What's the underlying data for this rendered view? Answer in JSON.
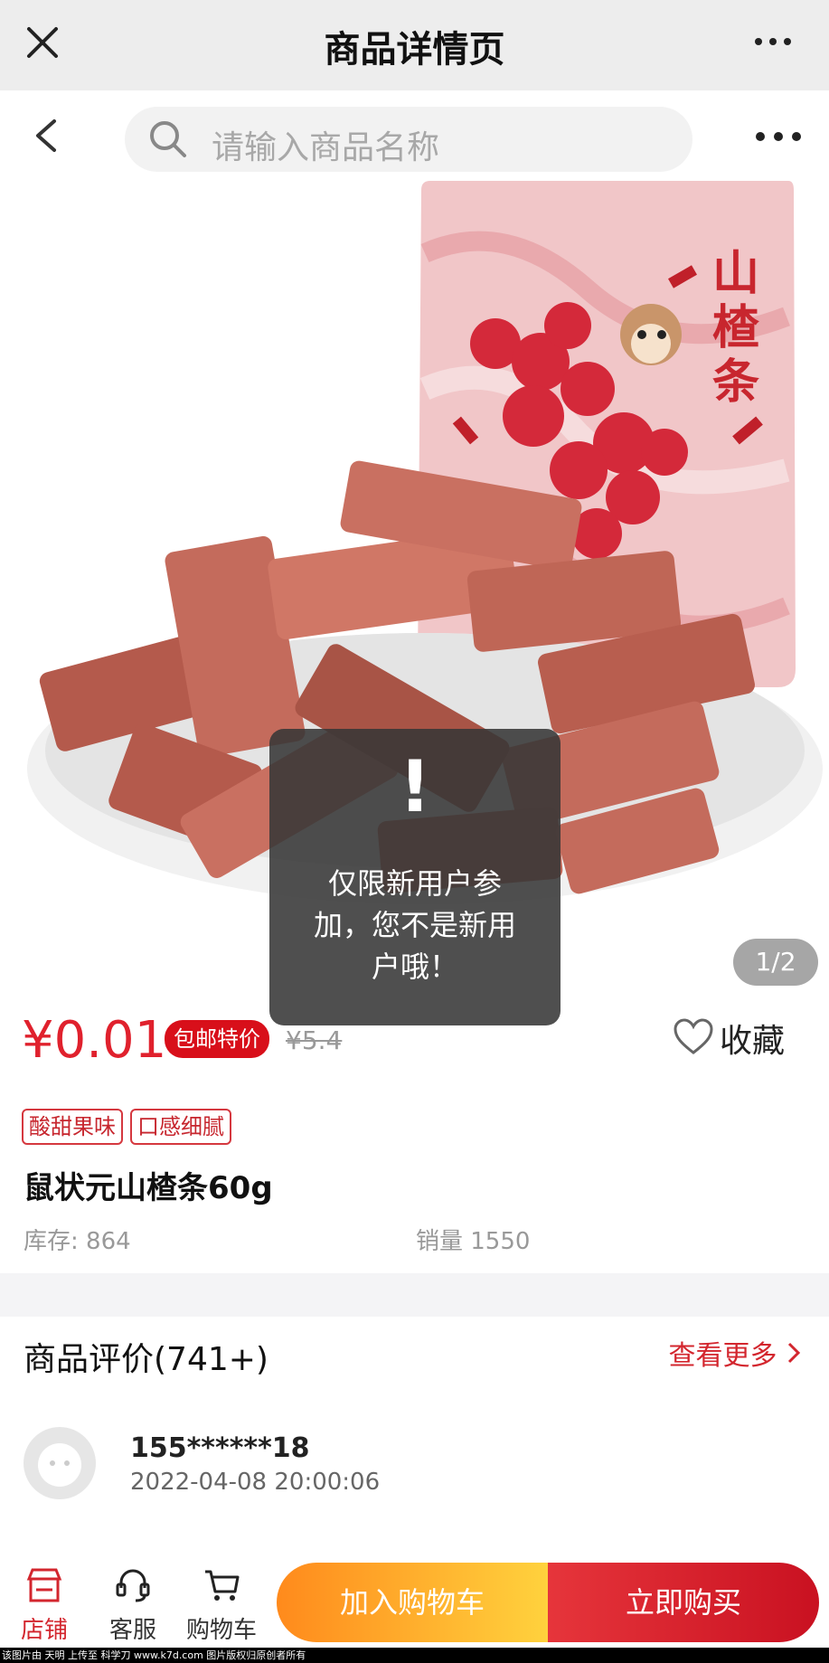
{
  "titlebar": {
    "title": "商品详情页",
    "close_icon": "close-icon",
    "more_icon": "more-dots-icon"
  },
  "search": {
    "placeholder": "请输入商品名称",
    "icon": "search-icon"
  },
  "image": {
    "pager": "1/2",
    "package_text": "山楂条"
  },
  "toast": {
    "mark": "!",
    "message": "仅限新用户参加，您不是新用户哦！"
  },
  "product": {
    "price": "¥0.01",
    "badge": "包邮特价",
    "original_price": "¥5.4",
    "favorite_label": "收藏",
    "tags": [
      "酸甜果味",
      "口感细腻"
    ],
    "name": "鼠状元山楂条60g",
    "stock": "库存: 864",
    "sales": "销量 1550"
  },
  "reviews": {
    "title": "商品评价(741+)",
    "see_more": "查看更多",
    "items": [
      {
        "user": "155******18",
        "time": "2022-04-08 20:00:06"
      }
    ]
  },
  "bottom": {
    "store": "店铺",
    "service": "客服",
    "cart": "购物车",
    "add_to_cart": "加入购物车",
    "buy_now": "立即购买"
  },
  "watermark": "该图片由 天明 上传至 科学刀 www.k7d.com 图片版权归原创者所有",
  "colors": {
    "accent_red": "#e0212d",
    "cart_orange": "#ff8a1c",
    "buy_red": "#d0182a"
  }
}
